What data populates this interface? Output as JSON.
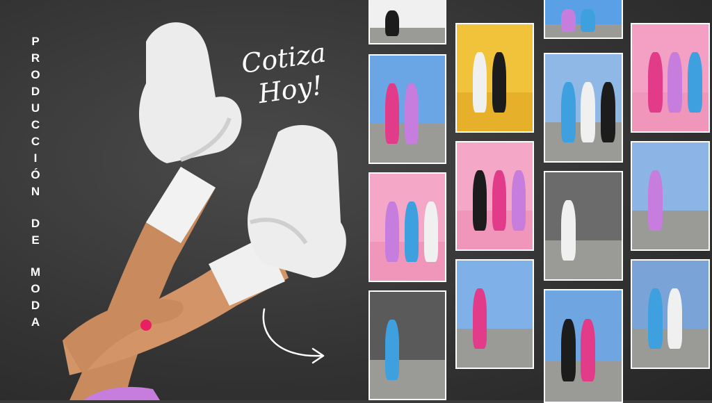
{
  "title_words": [
    "PRODUCCIÓN",
    "DE",
    "MODA"
  ],
  "tagline": {
    "line1": "Cotiza",
    "line2": "Hoy!"
  },
  "icons": {
    "arrow": "curved-arrow-icon"
  },
  "colors": {
    "background": "#3a3a3a",
    "text": "#ffffff",
    "pink": "#f5a3c7",
    "yellow": "#f2c230",
    "sky": "#5b9be0",
    "asphalt": "#8a8a86",
    "magenta": "#e91e63"
  },
  "gallery": [
    {
      "name": "photo-platform-heels-blue",
      "bg": "#f0f0f0"
    },
    {
      "name": "photo-two-girls-van",
      "bg": "#6aa6e6"
    },
    {
      "name": "photo-curly-girl-pink",
      "bg": "#f4a7c6"
    },
    {
      "name": "photo-girl-purple-gray",
      "bg": "#5a5a5a"
    },
    {
      "name": "photo-three-girls-yellow",
      "bg": "#f1c33a"
    },
    {
      "name": "photo-legs-black-platforms",
      "bg": "#f4a7c6"
    },
    {
      "name": "photo-skatepark-boombox",
      "bg": "#7fb0e8"
    },
    {
      "name": "photo-sky-hills",
      "bg": "#5aa0e6"
    },
    {
      "name": "photo-skateboard-pink-heels",
      "bg": "#8fb8e6"
    },
    {
      "name": "photo-three-girls-boombox",
      "bg": "#6b6b6b"
    },
    {
      "name": "photo-skatepark-pink-heels",
      "bg": "#6fa6e2"
    },
    {
      "name": "photo-three-girls-pink-blue",
      "bg": "#f3a0c4"
    },
    {
      "name": "photo-black-platform-boombox",
      "bg": "#8cb4e4"
    },
    {
      "name": "photo-two-girls-white-sneakers",
      "bg": "#7aa4d8"
    }
  ]
}
